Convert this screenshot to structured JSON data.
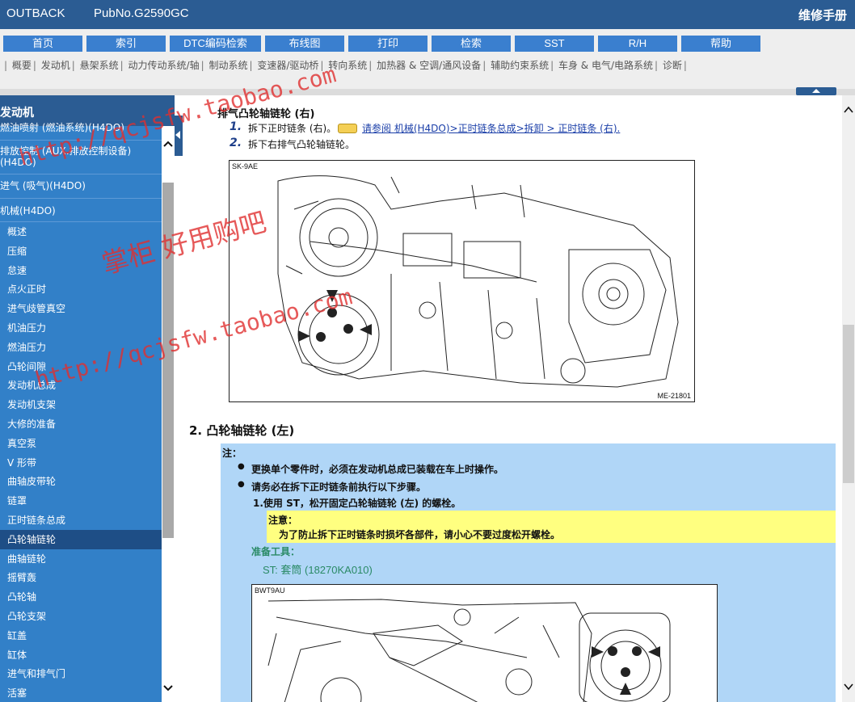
{
  "header": {
    "model": "OUTBACK",
    "pub_no": "PubNo.G2590GC",
    "manual_title": "维修手册"
  },
  "nav": {
    "buttons": [
      "首页",
      "索引",
      "DTC编码检索",
      "布线图",
      "打印",
      "检索",
      "SST",
      "R/H",
      "帮助"
    ],
    "systems": [
      "概要",
      "发动机",
      "悬架系统",
      "动力传动系统/轴",
      "制动系统",
      "变速器/驱动桥",
      "转向系统",
      "加热器 & 空调/通风设备",
      "辅助约束系统",
      "车身 & 电气/电路系统",
      "诊断"
    ]
  },
  "sidebar": {
    "title": "发动机",
    "groups": [
      "燃油喷射 (燃油系统)(H4DO)",
      "排放控制 (AUX.排放控制设备)",
      "(H4DO)",
      "进气 (吸气)(H4DO)",
      "机械(H4DO)"
    ],
    "items": [
      "概述",
      "压缩",
      "怠速",
      "点火正时",
      "进气歧管真空",
      "机油压力",
      "燃油压力",
      "凸轮间隙",
      "发动机总成",
      "发动机支架",
      "大修的准备",
      "真空泵",
      "V 形带",
      "曲轴皮带轮",
      "链罩",
      "正时链条总成",
      "凸轮轴链轮",
      "曲轴链轮",
      "摇臂轰",
      "凸轮轴",
      "凸轮支架",
      "缸盖",
      "缸体",
      "进气和排气门",
      "活塞"
    ],
    "active_item": "凸轮轴链轮"
  },
  "content": {
    "section_heading": "排气凸轮轴链轮 (右)",
    "steps": [
      {
        "num": "1.",
        "text": "拆下正时链条 (右)。",
        "link": "请参阅 机械(H4DO)>正时链条总成>拆卸 > 正时链条 (右)."
      },
      {
        "num": "2.",
        "text": "拆下右排气凸轮轴链轮。"
      }
    ],
    "figure1": {
      "code": "SK-9AE",
      "id": "ME-21801"
    },
    "heading2": "2. 凸轮轴链轮 (左)",
    "note": {
      "label": "注：",
      "bullets": [
        "更换单个零件时，必须在发动机总成已装载在车上时操作。",
        "请务必在拆下正时链条前执行以下步骤。"
      ],
      "substep": "1.使用 ST，松开固定凸轮轴链轮 (左) 的螺栓。",
      "caution_title": "注意：",
      "caution_text": "为了防止拆下正时链条时损坏各部件，请小心不要过度松开螺栓。",
      "prep_label": "准备工具：",
      "prep_value": "ST: 套筒 (18270KA010)"
    },
    "figure2": {
      "code": "BWT9AU"
    }
  },
  "watermarks": {
    "url": "http://qcjsfw.taobao.com",
    "shop": "掌柜 好用购吧"
  },
  "colors": {
    "header_blue": "#2b5c93",
    "nav_button": "#3a7fcf",
    "sidebar": "#3280c8",
    "note_bg": "#b0d6f7",
    "caution_bg": "#ffff80"
  }
}
